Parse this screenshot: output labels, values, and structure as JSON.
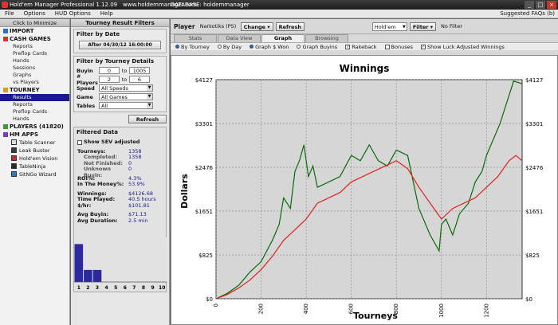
{
  "window": {
    "title": "Hold'em Manager Professional 1.12.09",
    "url": "www.holdemmanager.com",
    "database": "DATABASE: holdemmanager"
  },
  "menu": {
    "items": [
      "File",
      "Options",
      "HUD Options",
      "Help"
    ],
    "suggested": "Suggested FAQs (b)"
  },
  "nav": {
    "minimize": "Click to Minimize",
    "import": "IMPORT",
    "cash_games": "CASH GAMES",
    "cash_items": [
      "Reports",
      "Preflop Cards",
      "Hands",
      "Sessions",
      "Graphs",
      "vs Players"
    ],
    "tourney": "TOURNEY",
    "tourney_items": [
      "Results",
      "Reports",
      "Preflop Cards",
      "Hands"
    ],
    "players": "PLAYERS (41820)",
    "hm_apps": "HM APPS",
    "apps": [
      "Table Scanner",
      "Leak Buster",
      "Hold'em Vision",
      "TableNinja",
      "SitNGo Wizard"
    ]
  },
  "filters": {
    "header": "Tourney Result Filters",
    "by_date": "Filter by Date",
    "date_button": "After 04/30/12 16:00:00",
    "by_details": "Filter by Tourney Details",
    "buyin_label": "Buyin",
    "buyin_from": "0",
    "buyin_to": "1005",
    "players_label": "# Players",
    "players_from": "2",
    "players_to": "6",
    "to": "to",
    "speed_label": "Speed",
    "speed_value": "All Speeds",
    "game_label": "Game",
    "game_value": "All Games",
    "tables_label": "Tables",
    "tables_value": "All",
    "refresh": "Refresh"
  },
  "filtered": {
    "title": "Filtered Data",
    "sev_label": "Show SEV adjusted",
    "tourneys_k": "Tourneys:",
    "tourneys_v": "1358",
    "completed_k": "Completed:",
    "completed_v": "1358",
    "notfinished_k": "Not Finished:",
    "notfinished_v": "0",
    "unknown_k": "Unknown Buyin:",
    "unknown_v": "0",
    "roi_k": "ROI%:",
    "roi_v": "4.3%",
    "itm_k": "In The Money%:",
    "itm_v": "53.9%",
    "winnings_k": "Winnings:",
    "winnings_v": "$4126.68",
    "time_k": "Time Played:",
    "time_v": "40.5 hours",
    "hr_k": "$/hr:",
    "hr_v": "$101.81",
    "avgbuyin_k": "Avg Buyin:",
    "avgbuyin_v": "$71.13",
    "avgdur_k": "Avg Duration:",
    "avgdur_v": "2.5 min"
  },
  "mini_chart": {
    "labels": [
      "1",
      "2",
      "3",
      "4",
      "5",
      "6",
      "7",
      "8",
      "9",
      "10"
    ],
    "values": [
      0.85,
      0.27,
      0.27,
      0,
      0,
      0,
      0,
      0,
      0,
      0
    ],
    "color": "#2a2a9e"
  },
  "player_bar": {
    "label": "Player",
    "name": "Narkotiks (PS)",
    "change": "Change",
    "refresh": "Refresh",
    "game": "Hold'em",
    "filter": "Filter",
    "no_filter": "No Filter"
  },
  "tabs": [
    "Stats",
    "Data View",
    "Graph",
    "Browsing"
  ],
  "options": {
    "by_tourney": "By Tourney",
    "by_day": "By Day",
    "graph_won": "Graph $ Won",
    "graph_buyins": "Graph Buyins",
    "rakeback": "Rakeback",
    "bonuses": "Bonuses",
    "luck": "Show Luck Adjusted Winnings"
  },
  "chart_data": {
    "type": "line",
    "title": "Winnings",
    "xlabel": "Tourneys",
    "ylabel": "Dollars",
    "xlim": [
      0,
      1358
    ],
    "ylim": [
      0,
      4127
    ],
    "x_ticks": [
      0,
      200,
      400,
      600,
      800,
      1000,
      1200
    ],
    "y_ticks": [
      "$0",
      "$825",
      "$1651",
      "$2476",
      "$3301",
      "$4127"
    ],
    "y_tick_values": [
      0,
      825,
      1651,
      2476,
      3301,
      4127
    ],
    "grid": true,
    "series": [
      {
        "color": "#0a6a0a",
        "x": [
          0,
          50,
          100,
          150,
          200,
          250,
          280,
          300,
          330,
          350,
          370,
          390,
          410,
          430,
          450,
          500,
          550,
          600,
          640,
          680,
          720,
          760,
          800,
          850,
          900,
          950,
          990,
          1000,
          1020,
          1050,
          1080,
          1120,
          1150,
          1180,
          1200,
          1230,
          1260,
          1290,
          1320,
          1358
        ],
        "y": [
          0,
          100,
          250,
          500,
          700,
          1100,
          1400,
          1900,
          1700,
          2400,
          2600,
          2900,
          2300,
          2500,
          2100,
          2200,
          2300,
          2700,
          2600,
          2900,
          2600,
          2500,
          2800,
          2700,
          1700,
          1200,
          900,
          1400,
          1500,
          1200,
          1600,
          1800,
          2200,
          2400,
          2700,
          3000,
          3300,
          3700,
          4100,
          4050
        ]
      },
      {
        "color": "#e02020",
        "x": [
          0,
          50,
          100,
          150,
          200,
          250,
          300,
          350,
          400,
          450,
          500,
          550,
          600,
          650,
          700,
          750,
          800,
          850,
          900,
          950,
          1000,
          1050,
          1100,
          1150,
          1200,
          1250,
          1300,
          1330,
          1358
        ],
        "y": [
          0,
          80,
          200,
          350,
          550,
          800,
          1100,
          1300,
          1500,
          1800,
          1900,
          2000,
          2200,
          2300,
          2400,
          2500,
          2600,
          2450,
          2100,
          1800,
          1500,
          1700,
          1800,
          1900,
          2100,
          2300,
          2600,
          2700,
          2600
        ]
      }
    ]
  }
}
